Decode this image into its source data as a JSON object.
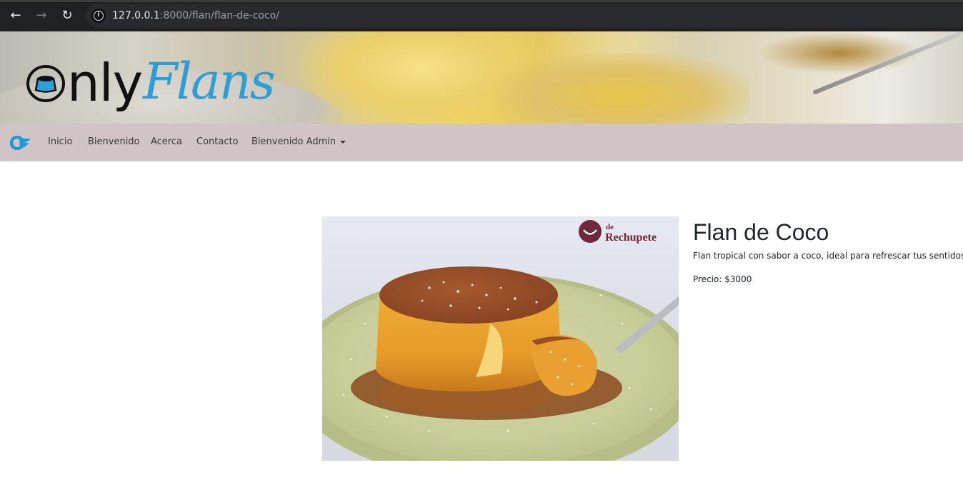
{
  "browser": {
    "url_host": "127.0.0.1",
    "url_rest": ":8000/flan/flan-de-coco/",
    "icons": {
      "back": "arrow-left-icon",
      "forward": "arrow-right-icon",
      "reload": "reload-icon",
      "info": "info-icon"
    }
  },
  "banner": {
    "logo_only": "nly",
    "logo_flans": "Flans"
  },
  "navbar": {
    "brand_icon": "onlyflans-brand-icon",
    "links": [
      {
        "label": "Inicio"
      },
      {
        "label": "Bienvenido"
      },
      {
        "label": "Acerca"
      },
      {
        "label": "Contacto"
      },
      {
        "label": "Bienvenido Admin"
      }
    ]
  },
  "product": {
    "image_watermark": "de Rechupete",
    "title": "Flan de Coco",
    "description": "Flan tropical con sabor a coco, ideal para refrescar tus sentidos.",
    "price": "Precio: $3000"
  },
  "colors": {
    "navbar_bg": "#d0c4c6",
    "logo_blue": "#2d9fd6",
    "chrome_bg": "#202124"
  }
}
